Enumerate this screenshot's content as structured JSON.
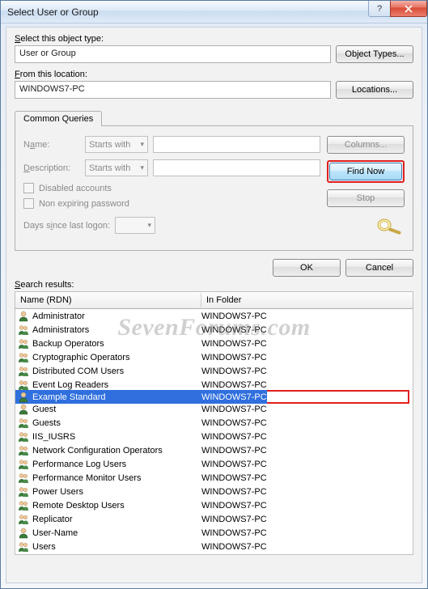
{
  "title": "Select User or Group",
  "objectTypeLabel": "Select this object type:",
  "objectTypeValue": "User or Group",
  "objectTypesBtn": "Object Types...",
  "locationLabel": "From this location:",
  "locationValue": "WINDOWS7-PC",
  "locationsBtn": "Locations...",
  "tabLabel": "Common Queries",
  "nameLabel": "Name:",
  "descLabel": "Description:",
  "startsWith": "Starts with",
  "chkDisabled": "Disabled accounts",
  "chkNonExpiring": "Non expiring password",
  "daysLabel": "Days since last logon:",
  "columnsBtn": "Columns...",
  "findNowBtn": "Find Now",
  "stopBtn": "Stop",
  "okBtn": "OK",
  "cancelBtn": "Cancel",
  "searchResultsLabel": "Search results:",
  "colName": "Name (RDN)",
  "colFolder": "In Folder",
  "watermark": "SevenForums.com",
  "results": [
    {
      "name": "Administrator",
      "folder": "WINDOWS7-PC",
      "type": "user",
      "sel": false
    },
    {
      "name": "Administrators",
      "folder": "WINDOWS7-PC",
      "type": "group",
      "sel": false
    },
    {
      "name": "Backup Operators",
      "folder": "WINDOWS7-PC",
      "type": "group",
      "sel": false
    },
    {
      "name": "Cryptographic Operators",
      "folder": "WINDOWS7-PC",
      "type": "group",
      "sel": false
    },
    {
      "name": "Distributed COM Users",
      "folder": "WINDOWS7-PC",
      "type": "group",
      "sel": false
    },
    {
      "name": "Event Log Readers",
      "folder": "WINDOWS7-PC",
      "type": "group",
      "sel": false
    },
    {
      "name": "Example Standard",
      "folder": "WINDOWS7-PC",
      "type": "user",
      "sel": true
    },
    {
      "name": "Guest",
      "folder": "WINDOWS7-PC",
      "type": "user",
      "sel": false
    },
    {
      "name": "Guests",
      "folder": "WINDOWS7-PC",
      "type": "group",
      "sel": false
    },
    {
      "name": "IIS_IUSRS",
      "folder": "WINDOWS7-PC",
      "type": "group",
      "sel": false
    },
    {
      "name": "Network Configuration Operators",
      "folder": "WINDOWS7-PC",
      "type": "group",
      "sel": false
    },
    {
      "name": "Performance Log Users",
      "folder": "WINDOWS7-PC",
      "type": "group",
      "sel": false
    },
    {
      "name": "Performance Monitor Users",
      "folder": "WINDOWS7-PC",
      "type": "group",
      "sel": false
    },
    {
      "name": "Power Users",
      "folder": "WINDOWS7-PC",
      "type": "group",
      "sel": false
    },
    {
      "name": "Remote Desktop Users",
      "folder": "WINDOWS7-PC",
      "type": "group",
      "sel": false
    },
    {
      "name": "Replicator",
      "folder": "WINDOWS7-PC",
      "type": "group",
      "sel": false
    },
    {
      "name": "User-Name",
      "folder": "WINDOWS7-PC",
      "type": "user",
      "sel": false
    },
    {
      "name": "Users",
      "folder": "WINDOWS7-PC",
      "type": "group",
      "sel": false
    }
  ]
}
